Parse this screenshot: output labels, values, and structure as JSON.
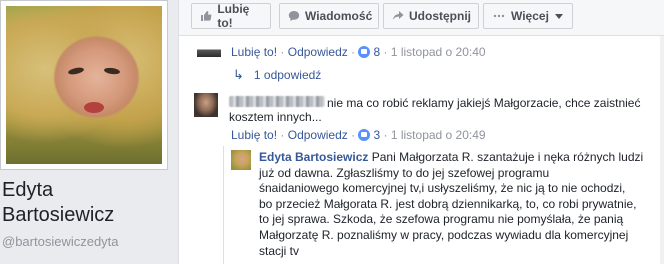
{
  "profile": {
    "name_line1": "Edyta",
    "name_line2": "Bartosiewicz",
    "handle": "@bartosiewiczedyta"
  },
  "actions": {
    "like": "Lubię to!",
    "message": "Wiadomość",
    "share": "Udostępnij",
    "more": "Więcej"
  },
  "comment1": {
    "like": "Lubię to!",
    "reply": "Odpowiedz",
    "likes_count": "8",
    "date": "1 listopad o 20:40",
    "replies_link": "1 odpowiedź"
  },
  "comment2": {
    "text_line1": "nie ma co robić reklamy jakiejś Małgorzacie, chce zaistnieć",
    "text_line2": "kosztem innych...",
    "like": "Lubię to!",
    "reply": "Odpowiedz",
    "likes_count": "3",
    "date": "1 listopad o 20:49"
  },
  "comment3": {
    "author": "Edyta Bartosiewicz",
    "lines": [
      "Pani Małgorzata R. szantażuje i nęka różnych ludzi",
      "już od dawna. Zgłaszliśmy to do jej szefowej programu",
      "śnaidaniowego komercyjnej tv,i usłyszeliśmy, że nic ją to nie ochodzi,",
      "bo przecież Małgorata R. jest dobrą dziennikarką, to, co robi prywatnie,",
      "to jej sprawa. Szkoda, że szefowa programu nie pomyślała, że panią",
      "Małgorzatę R. poznaliśmy w pracy, podczas wywiadu dla komercyjnej",
      "stacji tv"
    ]
  },
  "colors": {
    "link": "#365899",
    "meta": "#90949c",
    "background": "#e9ebee",
    "like_dot": "#5890ff"
  },
  "icons": {
    "like": "thumbs-up-icon",
    "message": "chat-bubble-icon",
    "share": "share-arrow-icon",
    "more": "ellipsis-icon",
    "reply_arrow": "reply-arrow-icon"
  }
}
